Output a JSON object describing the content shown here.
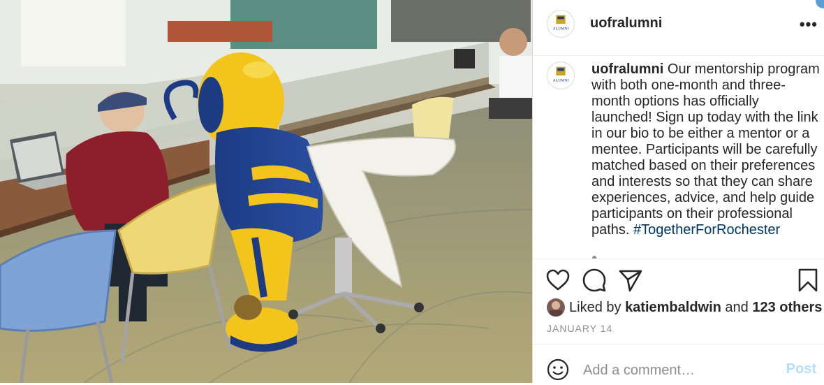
{
  "post": {
    "username": "uofralumni",
    "avatar_text": "ALUMNI",
    "caption": {
      "username": "uofralumni",
      "text": " Our mentorship program with both one-month and three-month options has officially launched! Sign up today with the link in our bio to be either a mentor or a mentee. Participants will be carefully matched based on their preferences and interests so that they can share experiences, advice, and help guide participants on their professional paths. ",
      "hashtag": "#TogetherForRochester"
    },
    "more_label": "•••",
    "likes": {
      "prefix": "Liked by ",
      "user": "katiembaldwin",
      "middle": " and ",
      "others": "123 others"
    },
    "date": "JANUARY 14",
    "comment": {
      "placeholder": "Add a comment…",
      "post_label": "Post"
    },
    "icons": {
      "like": "heart-icon",
      "comment": "comment-icon",
      "share": "paper-plane-icon",
      "save": "bookmark-icon",
      "emoji": "smiley-icon"
    },
    "colors": {
      "link": "#00376b",
      "post_disabled": "#b2dffc",
      "mascot_yellow": "#f3c41c",
      "mascot_blue": "#1d3b83"
    }
  }
}
